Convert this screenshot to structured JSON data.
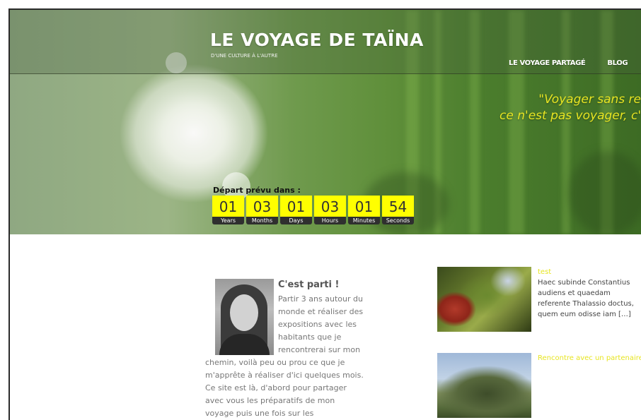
{
  "header": {
    "title": "LE VOYAGE DE TAÏNA",
    "tagline": "D'UNE CULTURE À L'AUTRE"
  },
  "nav": {
    "items": [
      {
        "label": "LE VOYAGE PARTAGÉ"
      },
      {
        "label": "BLOG"
      }
    ]
  },
  "quote": {
    "line1": "\"Voyager sans re",
    "line2": "ce n'est pas voyager, c'"
  },
  "countdown": {
    "label": "Départ prévu dans :",
    "units": [
      {
        "value": "01",
        "label": "Years"
      },
      {
        "value": "03",
        "label": "Months"
      },
      {
        "value": "01",
        "label": "Days"
      },
      {
        "value": "03",
        "label": "Hours"
      },
      {
        "value": "01",
        "label": "Minutes"
      },
      {
        "value": "54",
        "label": "Seconds"
      }
    ]
  },
  "post": {
    "title": "C'est parti !",
    "body": "Partir 3 ans autour du monde et réaliser des expositions avec les habitants que je rencontrerai sur mon chemin, voilà peu ou prou ce que je m'apprête à réaliser d'ici quelques mois. Ce site est là, d'abord pour partager avec vous les préparatifs de mon voyage puis une fois sur les"
  },
  "sidebar": {
    "items": [
      {
        "title": "test",
        "text": "Haec subinde Constantius audiens et quaedam referente Thalassio doctus, quem eum odisse iam […]"
      },
      {
        "title": "Rencontre avec un partenaire",
        "text": ""
      }
    ]
  },
  "colors": {
    "accent": "#e7e522",
    "countdown_bg": "#ffff00",
    "countdown_label_bg": "#2f2f2f"
  }
}
